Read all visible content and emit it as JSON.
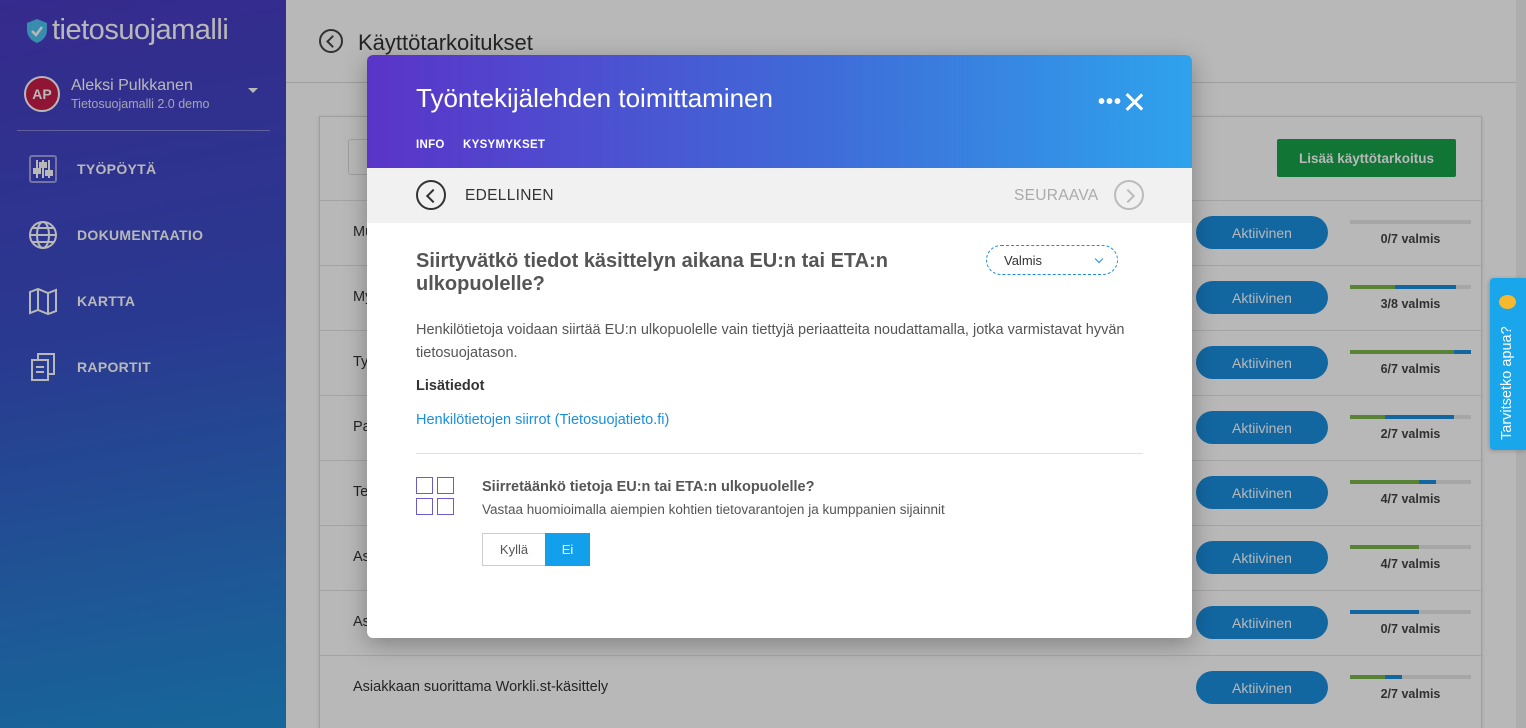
{
  "sidebar": {
    "logo_text": "tietosuojamalli",
    "user": {
      "initials": "AP",
      "name": "Aleksi Pulkkanen",
      "org": "Tietosuojamalli 2.0 demo"
    },
    "items": [
      {
        "label": "TYÖPÖYTÄ",
        "icon": "sliders-icon"
      },
      {
        "label": "DOKUMENTAATIO",
        "icon": "globe-icon"
      },
      {
        "label": "KARTTA",
        "icon": "map-icon"
      },
      {
        "label": "RAPORTIT",
        "icon": "documents-icon"
      }
    ]
  },
  "page": {
    "title": "Käyttötarkoitukset",
    "add_button": "Lisää käyttötarkoitus",
    "rows": [
      {
        "name": "Mu",
        "status": "Aktiivinen",
        "progress_label": "0/7 valmis",
        "green": 0,
        "blue": 0
      },
      {
        "name": "My",
        "status": "Aktiivinen",
        "progress_label": "3/8 valmis",
        "green": 0.375,
        "blue": 0.875
      },
      {
        "name": "Ty",
        "status": "Aktiivinen",
        "progress_label": "6/7 valmis",
        "green": 0.857,
        "blue": 1.0
      },
      {
        "name": "Pa",
        "status": "Aktiivinen",
        "progress_label": "2/7 valmis",
        "green": 0.286,
        "blue": 0.857
      },
      {
        "name": "Te",
        "status": "Aktiivinen",
        "progress_label": "4/7 valmis",
        "green": 0.571,
        "blue": 0.714
      },
      {
        "name": "As",
        "status": "Aktiivinen",
        "progress_label": "4/7 valmis",
        "green": 0.571,
        "blue": 0.571
      },
      {
        "name": "As",
        "status": "Aktiivinen",
        "progress_label": "0/7 valmis",
        "green": 0,
        "blue": 0.571
      },
      {
        "name": "Asiakkaan suorittama Workli.st-käsittely",
        "status": "Aktiivinen",
        "progress_label": "2/7 valmis",
        "green": 0.286,
        "blue": 0.429
      }
    ]
  },
  "help_tab": {
    "label": "Tarvitsetko apua?"
  },
  "modal": {
    "title": "Työntekijälehden toimittaminen",
    "more_label": "•••",
    "tabs": [
      "INFO",
      "KYSYMYKSET"
    ],
    "prev_label": "EDELLINEN",
    "next_label": "SEURAAVA",
    "question_title": "Siirtyvätkö tiedot käsittelyn aikana EU:n tai ETA:n ulkopuolelle?",
    "status_select": "Valmis",
    "description": "Henkilötietoja voidaan siirtää EU:n ulkopuolelle vain tiettyjä periaatteita noudattamalla, jotka varmistavat hyvän tietosuojatason.",
    "more_info_label": "Lisätiedot",
    "more_info_link": "Henkilötietojen siirrot (Tietosuojatieto.fi)",
    "sub_question": "Siirretäänkö tietoja EU:n tai ETA:n ulkopuolelle?",
    "sub_hint": "Vastaa huomioimalla aiempien kohtien tietovarantojen ja kumppanien sijainnit",
    "yes_label": "Kyllä",
    "no_label": "Ei",
    "selected_answer": "Ei"
  },
  "colors": {
    "accent": "#1a8fe0",
    "add_button": "#17a34a",
    "avatar": "#c81e4a"
  }
}
